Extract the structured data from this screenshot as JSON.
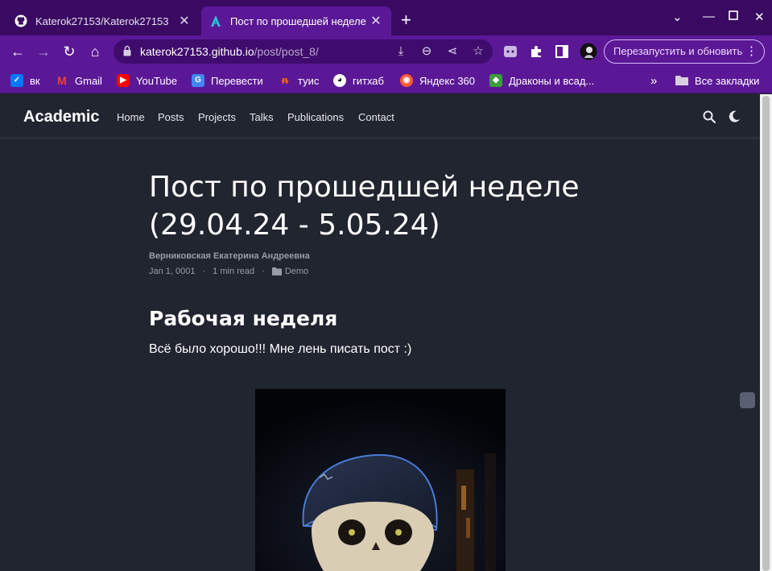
{
  "tabs": [
    {
      "title": "Katerok27153/Katerok27153",
      "active": false
    },
    {
      "title": "Пост по прошедшей неделе",
      "active": true
    }
  ],
  "toolbar": {
    "url_host": "katerok27153.github.io",
    "url_path": "/post/post_8/",
    "relaunch_label": "Перезапустить и обновить"
  },
  "bookmarks": [
    {
      "label": "вк",
      "icon": "vk-icon",
      "color": "#0077ff"
    },
    {
      "label": "Gmail",
      "icon": "gmail-icon",
      "color": "#ea4335"
    },
    {
      "label": "YouTube",
      "icon": "youtube-icon",
      "color": "#ff0000"
    },
    {
      "label": "Перевести",
      "icon": "translate-icon",
      "color": "#4285f4"
    },
    {
      "label": "туис",
      "icon": "tuis-icon",
      "color": "#ff6a00"
    },
    {
      "label": "гитхаб",
      "icon": "github-icon",
      "color": "#ffffff"
    },
    {
      "label": "Яндекс 360",
      "icon": "yandex360-icon",
      "color": "#ff5a36"
    },
    {
      "label": "Драконы и всад...",
      "icon": "dragons-icon",
      "color": "#3c9d3c"
    }
  ],
  "all_bookmarks_label": "Все закладки",
  "site": {
    "brand": "Academic",
    "nav": [
      "Home",
      "Posts",
      "Projects",
      "Talks",
      "Publications",
      "Contact"
    ]
  },
  "post": {
    "title": "Пост по прошедшей неделе (29.04.24 - 5.05.24)",
    "author": "Верниковская Екатерина Андреевна",
    "date": "Jan 1, 0001",
    "sep": "·",
    "reading_time": "1 min read",
    "category": "Demo",
    "heading": "Рабочая неделя",
    "text": "Всё было хорошо!!! Мне лень писать пост :)"
  }
}
